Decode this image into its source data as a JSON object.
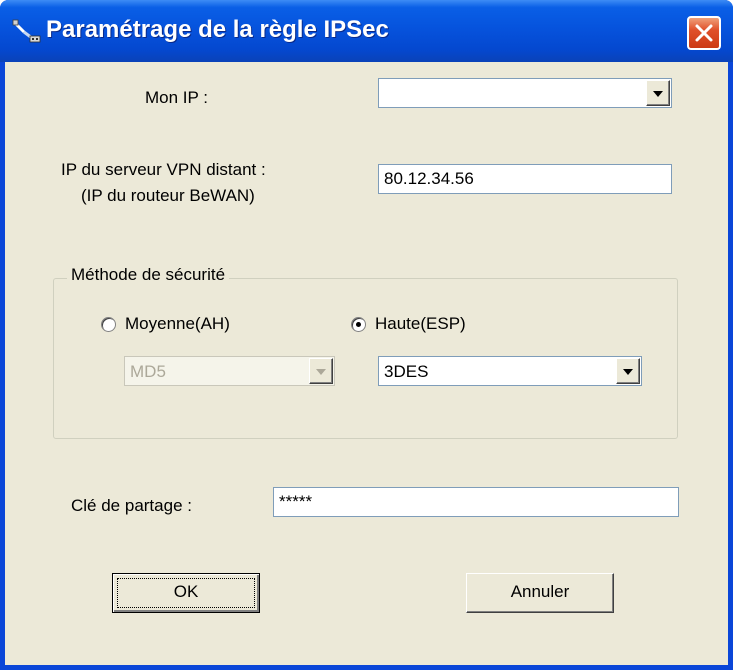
{
  "window": {
    "title": "Paramétrage de la règle IPSec",
    "icon": "network-cable-icon",
    "close_icon": "close-icon"
  },
  "fields": {
    "my_ip_label": "Mon IP :",
    "my_ip_value": "",
    "remote_vpn_label_line1": "IP du serveur VPN distant :",
    "remote_vpn_label_line2": "(IP du routeur BeWAN)",
    "remote_vpn_value": "80.12.34.56"
  },
  "security": {
    "legend": "Méthode de sécurité",
    "option_medium_label": "Moyenne(AH)",
    "option_medium_checked": false,
    "option_high_label": "Haute(ESP)",
    "option_high_checked": true,
    "medium_algo_value": "MD5",
    "medium_algo_disabled": true,
    "high_algo_value": "3DES"
  },
  "shared_key": {
    "label": "Clé de partage :",
    "value": "*****"
  },
  "buttons": {
    "ok_label": "OK",
    "cancel_label": "Annuler"
  },
  "colors": {
    "titlebar": "#0653dd",
    "client_bg": "#ece9d8",
    "close_button": "#e0502a",
    "input_border": "#7f9db9"
  }
}
